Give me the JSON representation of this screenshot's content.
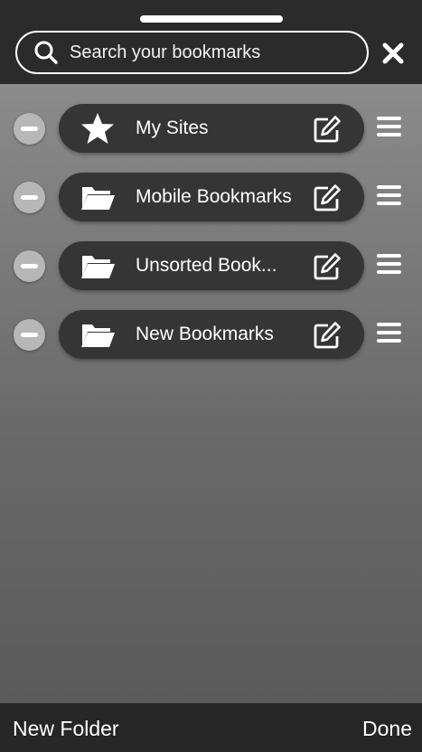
{
  "search": {
    "placeholder": "Search your bookmarks"
  },
  "bookmarks": [
    {
      "label": "My Sites",
      "icon": "star-icon"
    },
    {
      "label": "Mobile Bookmarks",
      "icon": "folder-icon"
    },
    {
      "label": "Unsorted Book...",
      "icon": "folder-icon"
    },
    {
      "label": "New Bookmarks",
      "icon": "folder-icon"
    }
  ],
  "footer": {
    "new_folder_label": "New Folder",
    "done_label": "Done"
  }
}
